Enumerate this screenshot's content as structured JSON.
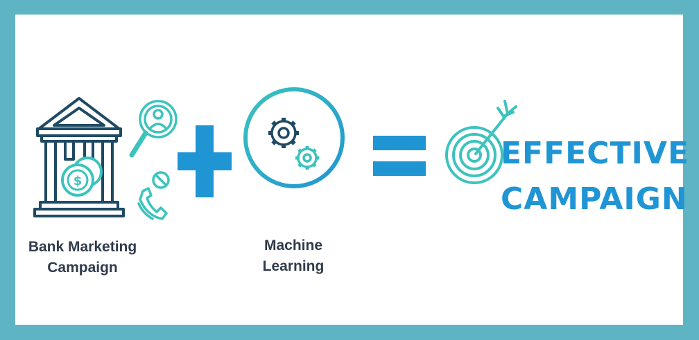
{
  "left_label": {
    "line1": "Bank Marketing",
    "line2": "Campaign"
  },
  "middle_label": {
    "line1": "Machine",
    "line2": "Learning"
  },
  "result": {
    "line1": "EFFECTIVE",
    "line2": "CAMPAIGN"
  },
  "icons": [
    "bank-icon",
    "coins-icon",
    "search-user-icon",
    "phone-icon",
    "plus-icon",
    "gears-icon",
    "equals-icon",
    "target-icon"
  ],
  "colors": {
    "frame_border": "#5fb4c4",
    "bank_stroke": "#1f4a63",
    "teal": "#3cc3bd",
    "blue": "#1f95d4",
    "label_text": "#2f3b4c"
  }
}
